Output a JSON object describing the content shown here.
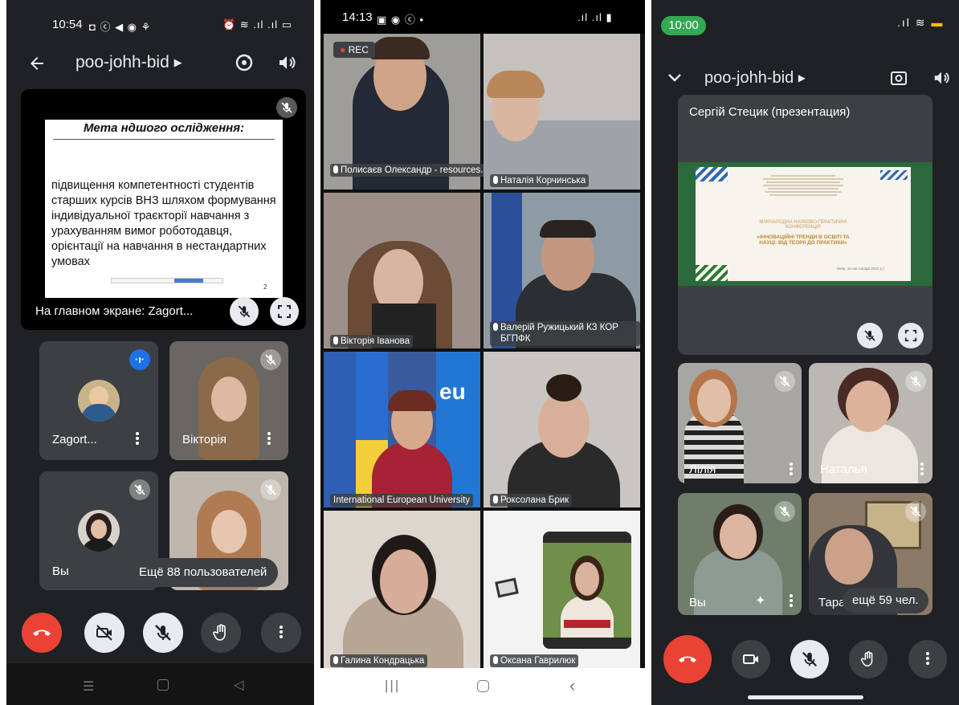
{
  "panel1": {
    "status_time": "10:54",
    "title": "poo-johh-bid",
    "slide_title": "Мета ндшого ослідження",
    "slide_body": "підвищення компетентності студентів старших курсів ВНЗ шляхом формування індивідуальної траєкторії навчання з урахуванням вимог роботодавця, орієнтації на навчання в нестандартних умовах",
    "slide_page": "2",
    "main_label": "На главном экране: Zagort...",
    "tiles": [
      "Zagort...",
      "Вікторія",
      "Вы"
    ],
    "more_users": "Ещё 88 пользователей"
  },
  "panel2": {
    "status_time": "14:13",
    "rec": "REC",
    "names": [
      "Полисаєв Олександр - resources.studio",
      "Наталія Корчинська",
      "Вікторія Іванова",
      "Валерій Ружицький КЗ КОР БГПФК",
      "International European University",
      "Роксолана Брик",
      "Галина Кондрацька",
      "Оксана Гаврилюк"
    ]
  },
  "panel3": {
    "status_time": "10:00",
    "title": "poo-johh-bid",
    "presenter": "Сергій Стецик (презентация)",
    "slide_line1": "МІЖНАРОДНА НАУКОВО-ПРАКТИЧНА",
    "slide_line2": "КОНФЕРЕНЦІЯ",
    "slide_line3": "«ІННОВАЦІЙНІ ТРЕНДИ В ОСВІТІ ТА",
    "slide_line4": "НАУЦІ: ВІД ТЕОРІЇ ДО ПРАКТИКИ»",
    "slide_date": "(Київ, 16 листопада 2022 р.)",
    "tiles": [
      "Лілія",
      "Наталья",
      "Вы",
      "Тара"
    ],
    "more_users": "ещё 59 чел."
  },
  "colors": {
    "dark_bg": "#202124",
    "tile_bg": "#3c4043",
    "end_call": "#ea4335",
    "speaking": "#1a73e8",
    "status_pill": "#34a853"
  },
  "icons": [
    "back-arrow-icon",
    "rotate-camera-icon",
    "speaker-icon",
    "mic-off-icon",
    "fullscreen-icon",
    "end-call-icon",
    "camera-off-icon",
    "raise-hand-icon",
    "more-vert-icon",
    "chevron-down-icon",
    "camera-icon",
    "sparkle-effects-icon",
    "chevron-right-icon"
  ]
}
